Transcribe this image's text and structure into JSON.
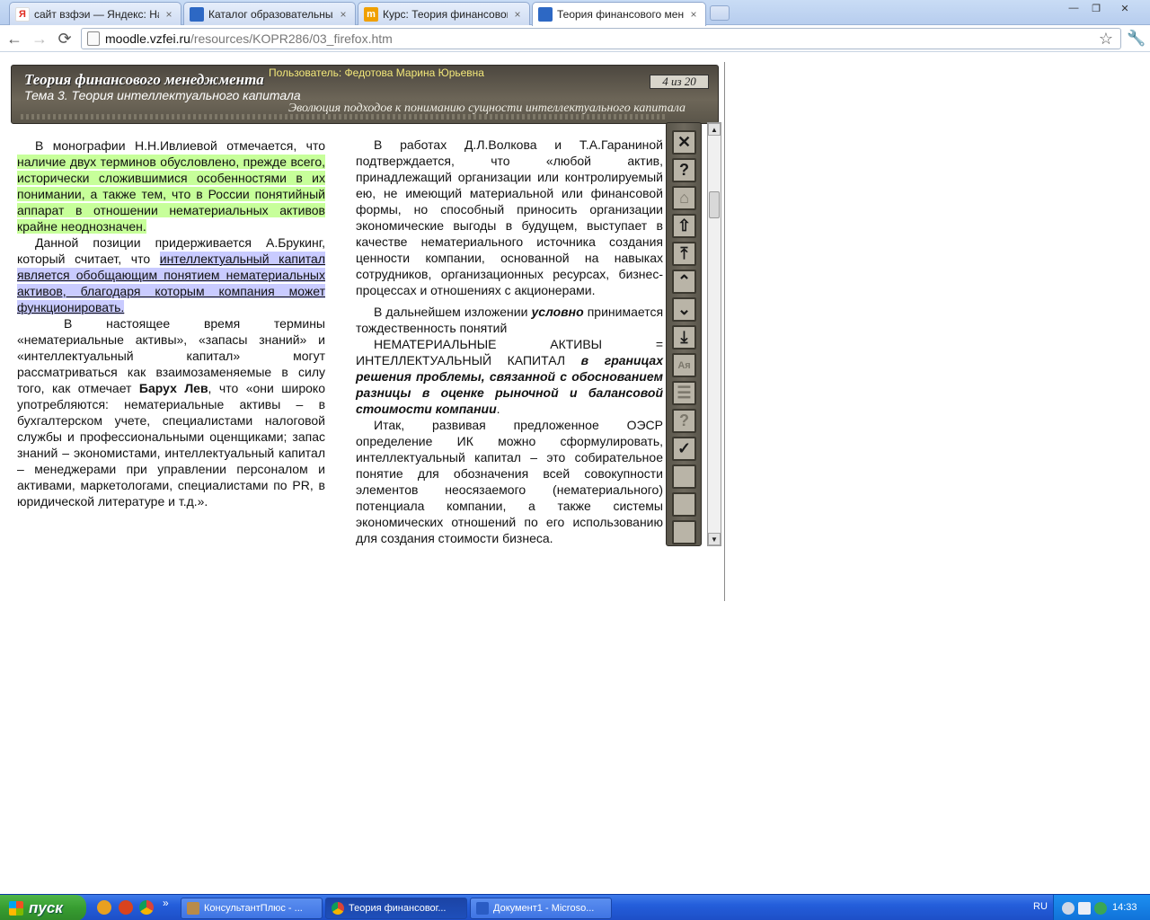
{
  "browser": {
    "tabs": [
      {
        "label": "сайт взфэи — Яндекс: Нашё",
        "favicon": "yandex-icon"
      },
      {
        "label": "Каталог образовательных р",
        "favicon": "folder-icon"
      },
      {
        "label": "Курс: Теория финансового м",
        "favicon": "moodle-icon"
      },
      {
        "label": "Теория финансового менедж",
        "favicon": "folder-icon"
      }
    ],
    "url_host": "moodle.vzfei.ru",
    "url_path": "/resources/KOPR286/03_firefox.htm",
    "icons": {
      "back": "←",
      "forward": "→",
      "reload": "⟳",
      "star": "☆",
      "wrench": "🔧",
      "close_tab": "×",
      "minimize": "—",
      "maximize": "❐",
      "close_window": "✕"
    }
  },
  "banner": {
    "course_title": "Теория финансового менеджмента",
    "user": "Пользователь: Федотова Марина Юрьевна",
    "topic": "Тема 3. Теория интеллектуального капитала",
    "page_counter": "4 из 20",
    "subtitle": "Эволюция подходов к пониманию сущности интеллектуального капитала"
  },
  "left_column": {
    "p1_a": "В монографии Н.Н.Ивлиевой отмечается, что",
    "p1_b": "наличие двух терминов обусловлено, прежде всего, исторически сложившимися особенностями в их понимании, а также тем, что в России понятийный аппарат в отношении нематериальных активов крайне неоднозначен.",
    "p2_a": "Данной позиции придерживается А.Брукинг, который считает, что",
    "p2_b": "интеллектуальный капитал является обобщающим понятием нематериальных активов, благодаря которым компания может функционировать.",
    "p3_a": "В настоящее время термины «нематериальные активы», «запасы знаний» и «интеллектуальный капитал» могут рассматриваться как взаимозаменяемые в силу того, как отмечает",
    "p3_name": "Барух Лев",
    "p3_b": ", что «они широко употребляются: нематериальные активы – в бухгалтерском учете, специалистами налоговой службы и профессиональными оценщиками; запас знаний – экономистами, интеллектуальный капитал – менеджерами при управлении персоналом и активами, маркетологами, специалистами по PR, в юридической литературе и т.д.»."
  },
  "right_column": {
    "p1": "В работах Д.Л.Волкова и Т.А.Гараниной подтверждается, что «любой актив, принадлежащий организации или контролируемый ею, не имеющий материальной или финансовой формы, но способный приносить организации экономические выгоды в будущем, выступает в качестве нематериального источника создания ценности компании, основанной на навыках сотрудников, организационных ресурсах, бизнес-процессах и отношениях с акционерами.",
    "p2_a": "В дальнейшем изложении",
    "p2_em": "условно",
    "p2_b": "принимается тождественность понятий",
    "p2_c": "НЕМАТЕРИАЛЬНЫЕ АКТИВЫ = ИНТЕЛЛЕКТУАЛЬНЫЙ КАПИТАЛ",
    "p2_em2": "в границах решения проблемы, связанной с обоснованием разницы в оценке рыночной и балансовой стоимости компании",
    "p2_end": ".",
    "p3_a": "Итак, развивая предложенное ОЭСР определение ИК можно сформулировать,",
    "p3_b": "интеллектуальный капитал – это собирательное понятие для обозначения всей совокупности элементов неосязаемого (нематериального) потенциала компании, а также системы экономических отношений по его использованию для создания стоимости бизнеса."
  },
  "controls": [
    {
      "name": "close-icon",
      "glyph": "✕",
      "dim": false
    },
    {
      "name": "help-icon",
      "glyph": "?",
      "dim": false
    },
    {
      "name": "home-icon",
      "glyph": "⌂",
      "dim": true
    },
    {
      "name": "arrow-up-icon",
      "glyph": "⇧",
      "dim": false
    },
    {
      "name": "first-page-icon",
      "glyph": "⤒",
      "dim": false
    },
    {
      "name": "prev-page-icon",
      "glyph": "⌃",
      "dim": false
    },
    {
      "name": "next-page-icon",
      "glyph": "⌄",
      "dim": false
    },
    {
      "name": "last-page-icon",
      "glyph": "⤓",
      "dim": false
    },
    {
      "name": "glossary-icon",
      "glyph": "Ая",
      "dim": true
    },
    {
      "name": "notes-icon",
      "glyph": "☰",
      "dim": true
    },
    {
      "name": "test-icon",
      "glyph": "?",
      "dim": true
    },
    {
      "name": "check-icon",
      "glyph": "✓",
      "dim": false
    },
    {
      "name": "blank-button-icon",
      "glyph": "",
      "dim": false
    },
    {
      "name": "blank-button-icon",
      "glyph": "",
      "dim": false
    },
    {
      "name": "blank-button-icon",
      "glyph": "",
      "dim": false
    }
  ],
  "taskbar": {
    "start_label": "пуск",
    "chevron": "»",
    "tasks": [
      {
        "label": "КонсультантПлюс - ...",
        "color": "#b88b4a"
      },
      {
        "label": "Теория финансовог...",
        "color": "#3b8f3b"
      },
      {
        "label": "Документ1 - Microso...",
        "color": "#2a5cc4"
      }
    ],
    "lang": "RU",
    "clock": "14:33"
  }
}
